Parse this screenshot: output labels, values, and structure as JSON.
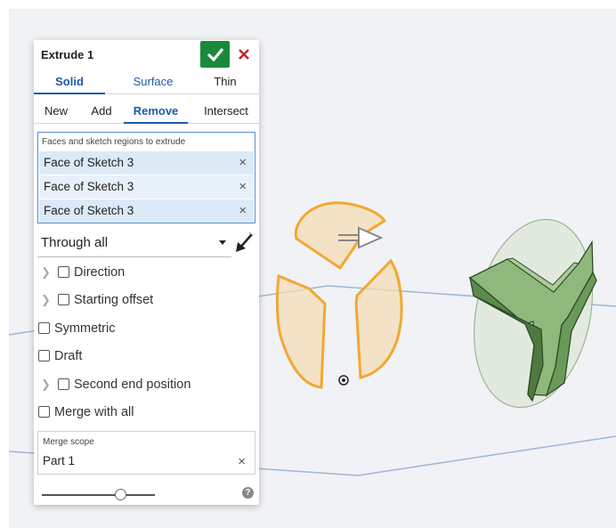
{
  "dialog": {
    "title": "Extrude 1",
    "tabs": [
      {
        "label": "Solid",
        "active": true
      },
      {
        "label": "Surface",
        "active": false
      },
      {
        "label": "Thin",
        "active": false
      }
    ],
    "operations": [
      {
        "label": "New",
        "active": false
      },
      {
        "label": "Add",
        "active": false
      },
      {
        "label": "Remove",
        "active": true
      },
      {
        "label": "Intersect",
        "active": false
      }
    ],
    "faces": {
      "label": "Faces and sketch regions to extrude",
      "items": [
        "Face of Sketch 3",
        "Face of Sketch 3",
        "Face of Sketch 3"
      ]
    },
    "end_type": {
      "value": "Through all"
    },
    "options": {
      "direction": "Direction",
      "starting_offset": "Starting offset",
      "symmetric": "Symmetric",
      "draft": "Draft",
      "second_end": "Second end position",
      "merge_all": "Merge with all"
    },
    "merge_scope": {
      "label": "Merge scope",
      "value": "Part 1"
    },
    "help": "?",
    "slider_level": 0.72
  },
  "colors": {
    "accent": "#1b5aa6",
    "ok": "#1a8a3a",
    "cancel": "#c0262c",
    "sketch_fill": "#f4dcb4",
    "sketch_stroke": "#f2a832",
    "part_green": "#7aa968"
  },
  "icons": [
    "check-icon",
    "close-icon",
    "flip-direction-icon",
    "chevron-right-icon",
    "help-icon",
    "origin-icon"
  ]
}
